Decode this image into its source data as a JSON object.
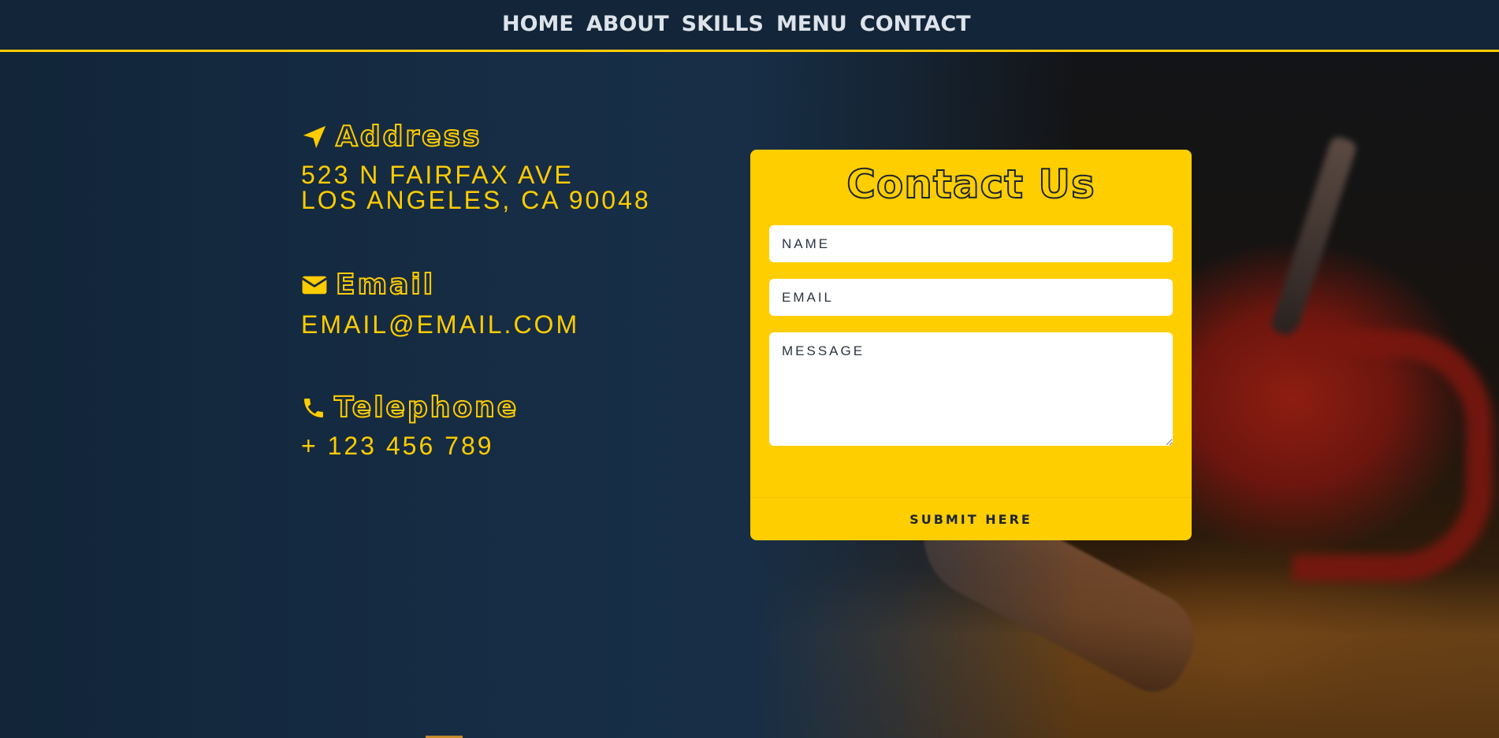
{
  "nav": {
    "items": [
      {
        "label": "HOME"
      },
      {
        "label": "ABOUT"
      },
      {
        "label": "SKILLS"
      },
      {
        "label": "MENU"
      },
      {
        "label": "CONTACT"
      }
    ]
  },
  "contact_info": {
    "address": {
      "title": "Address",
      "line1": "523 N FAIRFAX AVE",
      "line2": "LOS ANGELES, CA 90048",
      "icon": "location-arrow-icon"
    },
    "email": {
      "title": "Email",
      "value": "EMAIL@EMAIL.COM",
      "icon": "envelope-icon"
    },
    "telephone": {
      "title": "Telephone",
      "value": "+ 123 456 789",
      "icon": "phone-icon"
    }
  },
  "form": {
    "title": "Contact Us",
    "name_placeholder": "NAME",
    "email_placeholder": "EMAIL",
    "message_placeholder": "MESSAGE",
    "submit_label": "SUBMIT HERE"
  },
  "colors": {
    "accent": "#ffcc00",
    "navy": "#152a40",
    "dark_text": "#1b2534"
  }
}
